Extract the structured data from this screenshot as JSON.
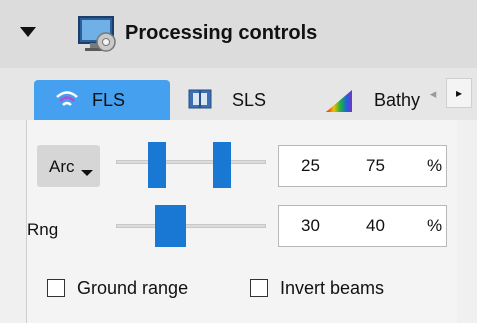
{
  "header": {
    "title": "Processing controls",
    "icon": "processing-monitor-icon"
  },
  "tabs": [
    {
      "label": "FLS",
      "icon": "wifi-signal-icon",
      "active": true
    },
    {
      "label": "SLS",
      "icon": "sidescan-icon",
      "active": false
    },
    {
      "label": "Bathy",
      "icon": "color-spectrum-icon",
      "active": false
    }
  ],
  "tab_scroll": {
    "left": "◂",
    "right": "▸"
  },
  "arc": {
    "label": "Arc",
    "low": "25",
    "high": "75",
    "unit": "%",
    "slider_low_fraction": 0.25,
    "slider_high_fraction": 0.75
  },
  "rng": {
    "label": "Rng",
    "low": "30",
    "high": "40",
    "unit": "%",
    "slider_low_fraction": 0.3,
    "slider_high_fraction": 0.4
  },
  "options": {
    "ground_range": "Ground range",
    "invert_beams": "Invert beams",
    "ground_range_checked": false,
    "invert_beams_checked": false
  },
  "colors": {
    "accent": "#46a0f0",
    "slider_handle": "#1978d4",
    "header_bg": "#dcdcdc"
  }
}
